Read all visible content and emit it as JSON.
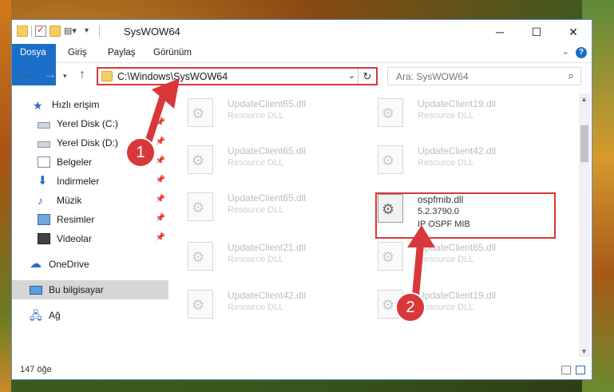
{
  "window": {
    "title": "SysWOW64",
    "controls": {
      "minimize": "─",
      "maximize": "☐",
      "close": "✕"
    }
  },
  "ribbon": {
    "tabs": [
      "Dosya",
      "Giriş",
      "Paylaş",
      "Görünüm"
    ],
    "help": "?"
  },
  "navigation": {
    "address_path": "C:\\Windows\\SysWOW64",
    "search_placeholder": "Ara: SysWOW64"
  },
  "sidebar": {
    "items": [
      {
        "label": "Hızlı erişim",
        "icon": "star-icon"
      },
      {
        "label": "Yerel Disk (C:)",
        "icon": "disk-icon",
        "pinned": true
      },
      {
        "label": "Yerel Disk (D:)",
        "icon": "disk-icon",
        "pinned": true
      },
      {
        "label": "Belgeler",
        "icon": "documents-icon",
        "pinned": true
      },
      {
        "label": "İndirmeler",
        "icon": "download-icon",
        "pinned": true
      },
      {
        "label": "Müzik",
        "icon": "music-icon",
        "pinned": true
      },
      {
        "label": "Resimler",
        "icon": "pictures-icon",
        "pinned": true
      },
      {
        "label": "Videolar",
        "icon": "videos-icon",
        "pinned": true
      },
      {
        "label": "OneDrive",
        "icon": "cloud-icon"
      },
      {
        "label": "Bu bilgisayar",
        "icon": "computer-icon",
        "selected": true
      },
      {
        "label": "Ağ",
        "icon": "network-icon"
      }
    ]
  },
  "files": [
    {
      "name": "UpdateClient65.dll",
      "desc": "Resource DLL"
    },
    {
      "name": "UpdateClient19.dll",
      "desc": "Resource DLL"
    },
    {
      "name": "UpdateClient65.dll",
      "desc": "Resource DLL"
    },
    {
      "name": "UpdateClient42.dll",
      "desc": "Resource DLL"
    },
    {
      "name": "UpdateClient65.dll",
      "desc": "Resource DLL"
    },
    {
      "name": "ospfmib.dll",
      "desc": "5.2.3790.0",
      "desc2": "IP OSPF MIB",
      "highlighted": true
    },
    {
      "name": "UpdateClient21.dll",
      "desc": "Resource DLL"
    },
    {
      "name": "UpdateClient65.dll",
      "desc": "Resource DLL"
    },
    {
      "name": "UpdateClient42.dll",
      "desc": "Resource DLL"
    },
    {
      "name": "UpdateClient19.dll",
      "desc": "Resource DLL"
    }
  ],
  "status": {
    "item_count": "147 öğe"
  },
  "annotations": {
    "step1": "1",
    "step2": "2",
    "color": "#d9383a"
  }
}
